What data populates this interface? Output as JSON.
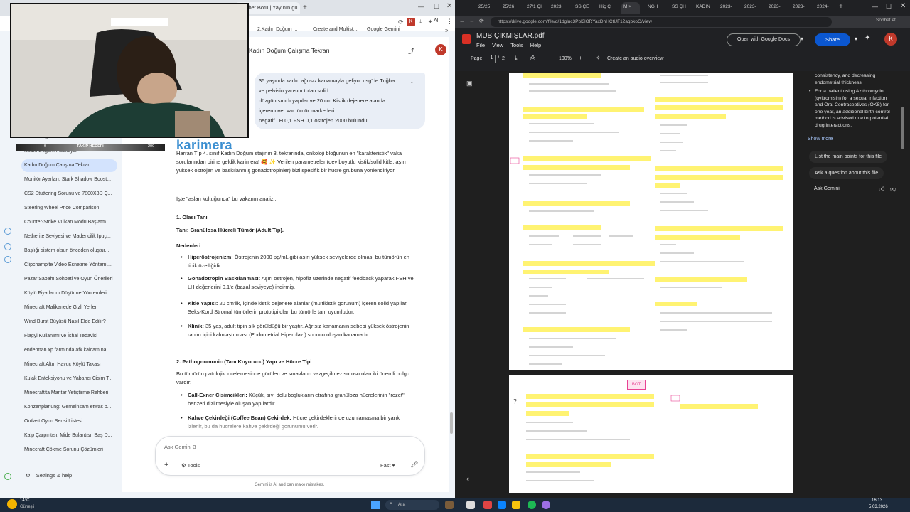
{
  "left_window": {
    "tabs": [
      "Sohbet Botu | Yayının gu..."
    ],
    "bookmarks": [
      "2.Kadın Doğum ...",
      "Create and Multist...",
      "Google Gemini"
    ],
    "profile_letter": "K",
    "ai_label": "AI",
    "chat_title": "Kadın Doğum Çalışma Tekrarı",
    "user_message": [
      "35 yaşında kadın ağrısız kanamayla geliyor usg'de Tuğba",
      "ve pelvisin yarısını tutan solid",
      "düzgün sınırlı yapılar ve 20 cm Kistik dejenere alanda",
      "içeren over var tümör markerleri",
      "negatif LH 0,1 FSH 0,1 östrojen 2000 bulundu ...."
    ],
    "brand_overlay": "karimera",
    "goal_bar": {
      "left": "0",
      "label": "TAKİP HEDEFİ",
      "right": "200"
    },
    "sidebar_items": [
      "Kadın Doğum Sorular",
      "Kadın Doğum İncelleyik",
      "Kadın Doğum Çalışma Tekrarı",
      "Monitör Ayarları: Stark Shadow Boost...",
      "CS2 Stuttering Sorunu ve 7800X3D Ç...",
      "Steering Wheel Price Comparison",
      "Counter-Strike Vulkan Modu Başlatm...",
      "Netherite Seviyesi ve Madencilik İpuç...",
      "Başlığı sistem olsun önceden oluştur...",
      "Clipchamp'te Video Esnetme Yöntemi...",
      "Pazar Sabahı Sohbeti ve Oyun Önerileri",
      "Köylü Fiyatlarını Düşürme Yöntemleri",
      "Minecraft Malikanede Gizli Yerler",
      "Wind Burst Büyüsü Nasıl Elde Edilir?",
      "Flagyl Kullanımı ve İshal Tedavisi",
      "enderman xp farmında afk kalcam na...",
      "Minecraft Altın Havuç Köylü Takası",
      "Kulak Enfeksiyonu ve Yabancı Cisim T...",
      "Minecraft'ta Mantar Yetiştirme Rehberi",
      "Konzertplanung: Gemeinsam etwas p...",
      "Outlast Oyun Serisi Listesi",
      "Kalp Çarpıntısı, Mide Bulantısı, Baş D...",
      "Minecraft Çökme Sorunu Çözümleri"
    ],
    "settings_label": "Settings & help",
    "response": {
      "intro": "Harran Tıp 4. sınıf Kadın Doğum stajının 3. tekrarında, onkoloji bloğunun en \"karakteristik\" vaka sorularından birine geldik karimera! 🥰 ✨ Verilen parametreler (dev boyutlu kistik/solid kitle, aşırı yüksek östrojen ve baskılanmış gonadotropinler) bizi spesifik bir hücre grubuna yönlendiriyor.",
      "analysis": "İşte \"aslan koltuğunda\" bu vakanın analizi:",
      "h1": "1. Olası Tanı",
      "diagnosis_label": "Tanı:",
      "diagnosis": "Granülosa Hücreli Tümör (Adult Tip).",
      "reasons_label": "Nedenleri:",
      "reasons": [
        {
          "b": "Hiperöstrojenizm:",
          "t": "Östrojenin 2000 pg/mL gibi aşırı yüksek seviyelerde olması bu tümörün en tipik özelliğidir."
        },
        {
          "b": "Gonadotropin Baskılanması:",
          "t": "Aşırı östrojen, hipofiz üzerinde negatif feedback yaparak FSH ve LH değerlerini 0,1'e (bazal seviyeye) indirmiş."
        },
        {
          "b": "Kitle Yapısı:",
          "t": "20 cm'lik, içinde kistik dejenere alanlar (multikistik görünüm) içeren solid yapılar, Seks-Kord Stromal tümörlerin prototipi olan bu tümörle tam uyumludur."
        },
        {
          "b": "Klinik:",
          "t": "35 yaş, adult tipin sık görüldüğü bir yaştır. Ağrısız kanamanın sebebi yüksek östrojenin rahim içini kalınlaştırması (Endometrial Hiperplazi) sonucu oluşan kanamadır."
        }
      ],
      "h2": "2. Pathognomonic (Tanı Koyurucu) Yapı ve Hücre Tipi",
      "h2_text": "Bu tümörün patolojik incelemesinde görülen ve sınavların vazgeçilmez sorusu olan iki önemli bulgu vardır:",
      "findings": [
        {
          "b": "Call-Exner Cisimcikleri:",
          "t": "Küçük, sıvı dolu boşlukların etrafına granüloza hücrelerinin \"rozet\" benzeri dizilmesiyle oluşan yapılardır."
        },
        {
          "b": "Kahve Çekirdeği (Coffee Bean) Çekirdek:",
          "t": "Hücre çekirdeklerinde uzunlamasına bir yarık izlenir, bu da hücrelere kahve çekirdeği görünümü verir."
        }
      ]
    },
    "ask_placeholder": "Ask Gemini 3",
    "tools_label": "Tools",
    "mode_label": "Fast",
    "disclaimer": "Gemini is AI and can make mistakes."
  },
  "right_window": {
    "tabs": [
      "25/25",
      "25/26",
      "27/1 ÇI",
      "2023",
      "SS ÇE",
      "Hiç Ç",
      "M ×",
      "NGH",
      "SS ÇH",
      "KADIN",
      "2023-",
      "2023-",
      "2023-",
      "2023-",
      "2024-"
    ],
    "url": "https://drive.google.com/file/d/1dgluc3Pbl3lORYaxDhHCtUF12aqbkoO/view",
    "chat_label": "Sohbet et",
    "file_title": "MUB ÇIKMIŞLAR.pdf",
    "menu": [
      "File",
      "View",
      "Tools",
      "Help"
    ],
    "open_with": "Open with Google Docs",
    "share": "Share",
    "page_label": "Page",
    "page_current": "1",
    "page_sep": "/",
    "page_total": "2",
    "zoom": "100%",
    "audio_overview": "Create an audio overview",
    "gemini_panel": {
      "lines": [
        "consistency, and decreasing",
        "endometrial thickness."
      ],
      "bullet": [
        "For a patient using Azithromycin",
        "(qvitromisin) for a sexual infection",
        "and Oral Contraceptives (OKS) for",
        "one year, an additional birth control",
        "method is advised due to potential",
        "drug interactions."
      ],
      "show_more": "Show more",
      "suggestions": [
        "List the main points for this file",
        "Ask a question about this file"
      ],
      "ask": "Ask Gemini"
    },
    "pdf_page2_tag": "BOT"
  },
  "taskbar": {
    "temp": "14°C",
    "weather": "Güneşli",
    "search": "Ara",
    "time": "16:13",
    "date": "5.03.2026"
  }
}
